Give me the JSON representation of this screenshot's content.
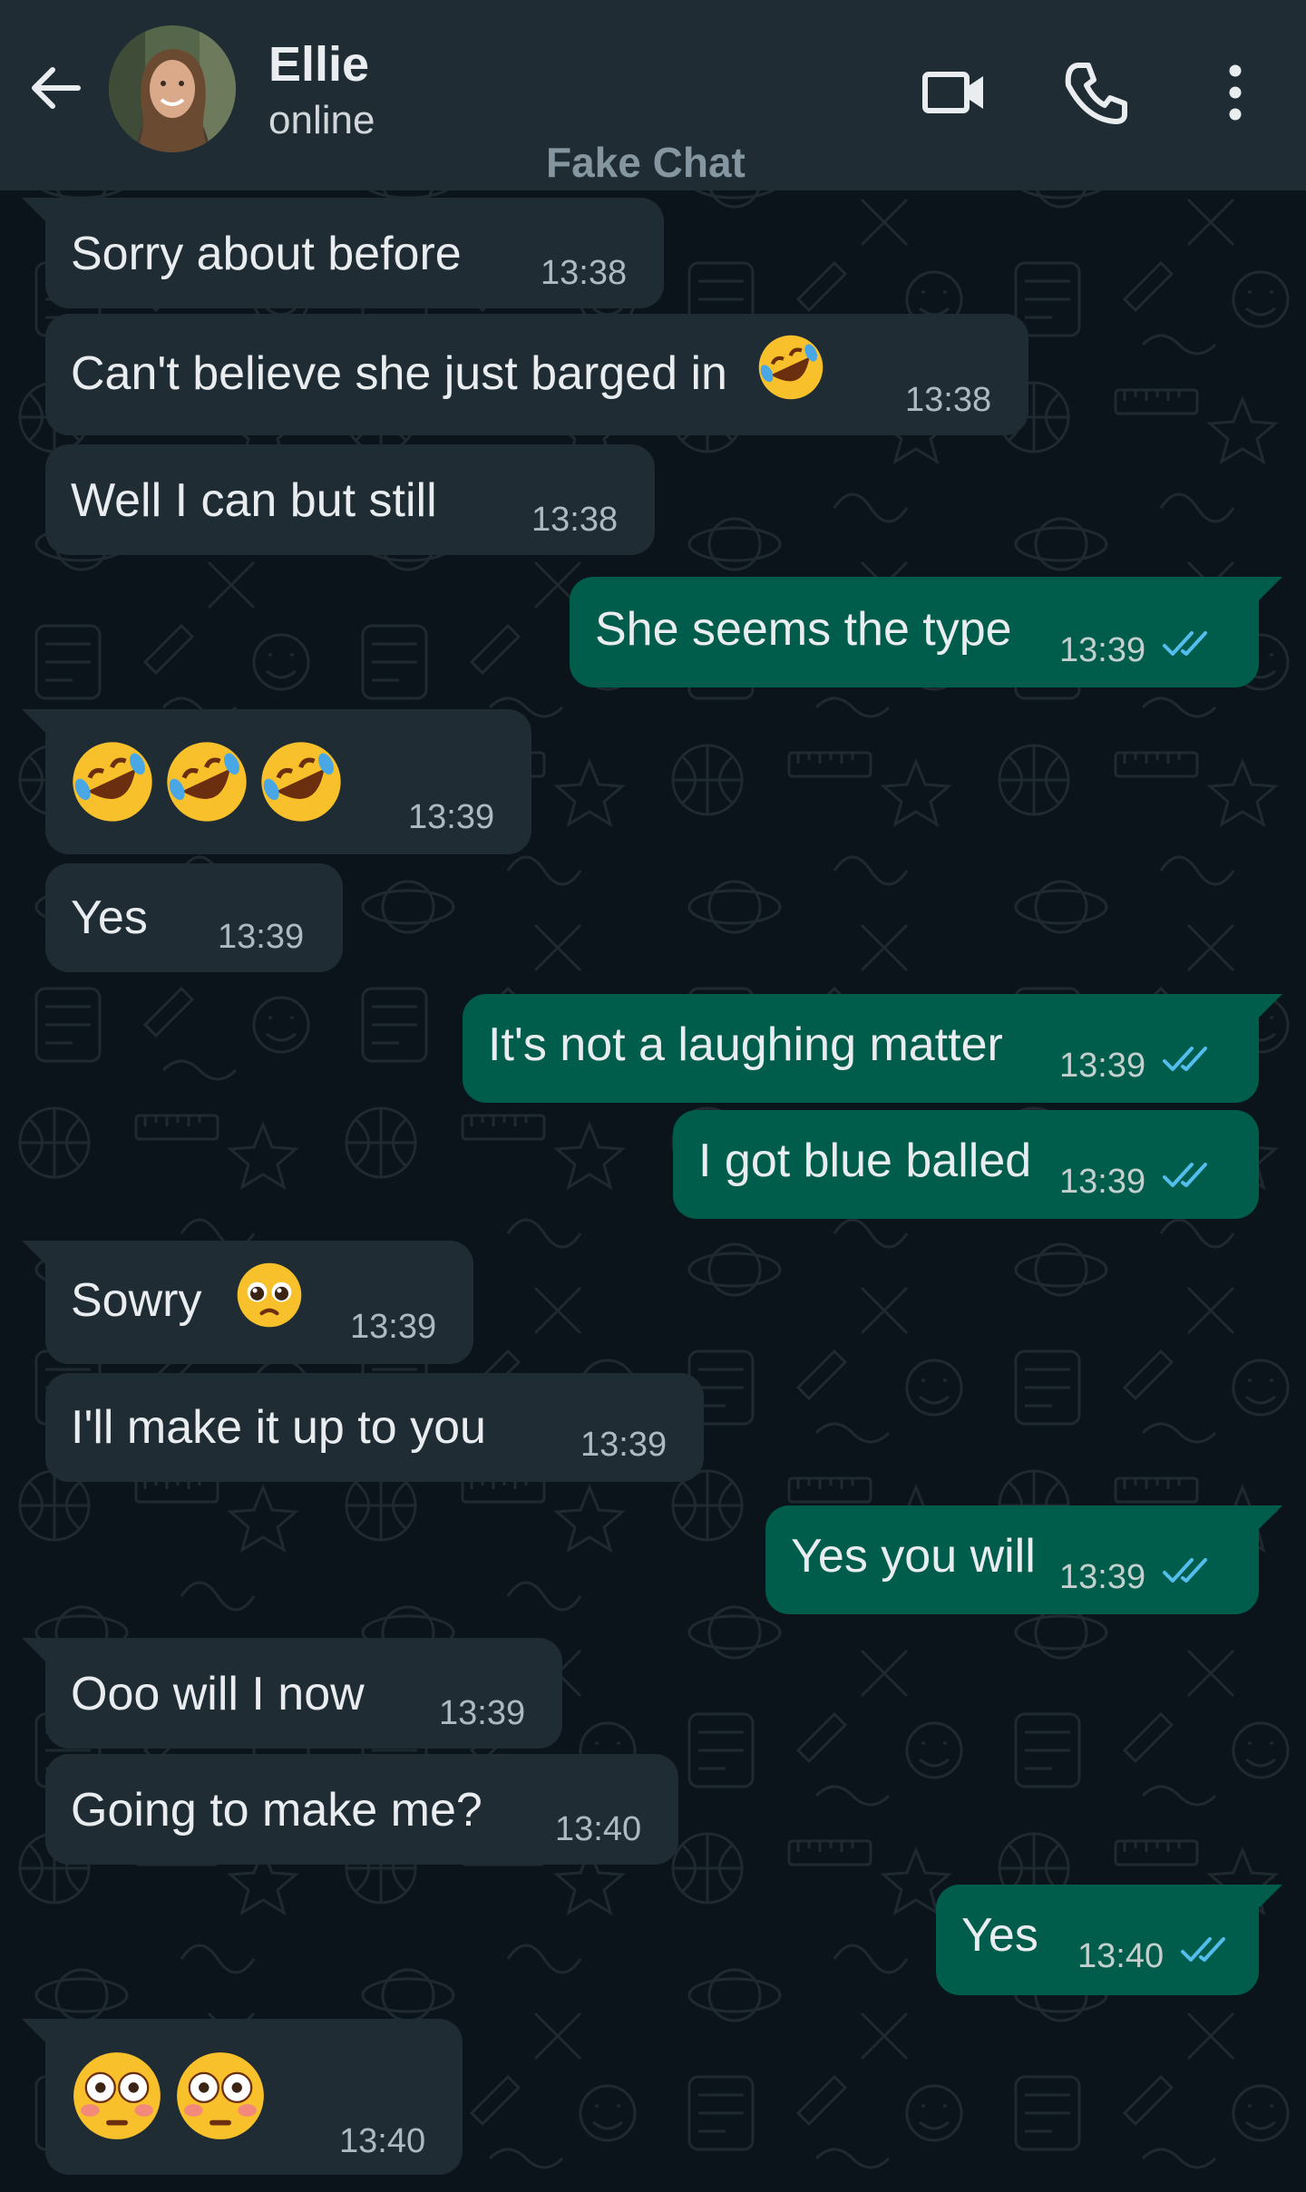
{
  "header": {
    "contact_name": "Ellie",
    "contact_status": "online",
    "watermark": "Fake Chat",
    "icons": [
      "back-arrow-icon",
      "video-call-icon",
      "phone-icon",
      "more-vert-icon"
    ]
  },
  "colors": {
    "header_bg": "#1f2c33",
    "chat_bg": "#0b141a",
    "incoming_bubble": "#1f2c33",
    "outgoing_bubble": "#005c4b",
    "read_ticks": "#53bdeb",
    "text": "#e9edef"
  },
  "messages": [
    {
      "direction": "in",
      "text": "Sorry about before",
      "time": "13:38"
    },
    {
      "direction": "in",
      "text": "Can't believe she just barged in",
      "emoji": "rolling-on-floor-laughing",
      "time": "13:38"
    },
    {
      "direction": "in",
      "text": "Well I can but still",
      "time": "13:38"
    },
    {
      "direction": "out",
      "text": "She seems the type",
      "time": "13:39",
      "status": "read"
    },
    {
      "direction": "in",
      "emoji": "rolling-on-floor-laughing x3",
      "time": "13:39"
    },
    {
      "direction": "in",
      "text": "Yes",
      "time": "13:39"
    },
    {
      "direction": "out",
      "text": "It's not a laughing matter",
      "time": "13:39",
      "status": "read"
    },
    {
      "direction": "out",
      "text": "I got blue balled",
      "time": "13:39",
      "status": "read"
    },
    {
      "direction": "in",
      "text": "Sowry",
      "emoji": "pleading-face",
      "time": "13:39"
    },
    {
      "direction": "in",
      "text": "I'll make it up to you",
      "time": "13:39"
    },
    {
      "direction": "out",
      "text": "Yes you will",
      "time": "13:39",
      "status": "read"
    },
    {
      "direction": "in",
      "text": "Ooo will I now",
      "time": "13:39"
    },
    {
      "direction": "in",
      "text": "Going to make me?",
      "time": "13:40"
    },
    {
      "direction": "out",
      "text": "Yes",
      "time": "13:40",
      "status": "read"
    },
    {
      "direction": "in",
      "emoji": "flushed-face x2",
      "time": "13:40"
    }
  ]
}
